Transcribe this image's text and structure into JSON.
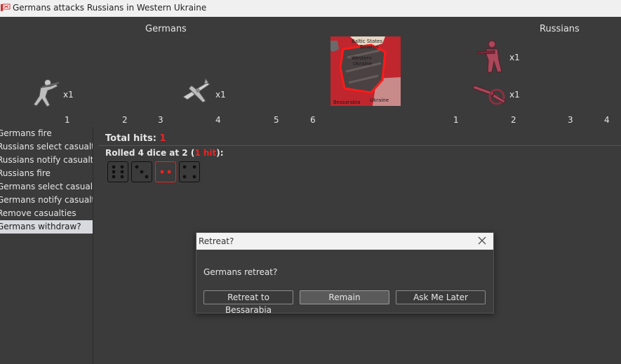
{
  "window": {
    "title": "Germans attacks Russians in Western Ukraine"
  },
  "attacker": {
    "name": "Germans",
    "units": [
      {
        "icon": "infantry-icon",
        "count": "x1"
      },
      {
        "icon": "fighter-plane-icon",
        "count": "x1"
      }
    ],
    "columns": [
      "1",
      "2",
      "3",
      "4",
      "5",
      "6"
    ]
  },
  "defender": {
    "name": "Russians",
    "units": [
      {
        "icon": "infantry-icon",
        "count": "x1"
      },
      {
        "icon": "artillery-icon",
        "count": "x1"
      }
    ],
    "columns": [
      "1",
      "2",
      "3",
      "4"
    ]
  },
  "territory": {
    "name_line1": "Western",
    "name_line2": "Ukraine",
    "top_label_line1": "Baltic States",
    "top_label_line2": "Belarus",
    "bottom_left_label": "Bessarabia",
    "bottom_right_label": "Ukraine",
    "colors": {
      "owner": "#c0262e",
      "highlight": "#ff1a1a"
    }
  },
  "steps": [
    "Germans fire",
    "Russians select casualties",
    "Russians notify casualties",
    "Russians fire",
    "Germans select casualties",
    "Germans notify casualties",
    "Remove casualties",
    "Germans withdraw?"
  ],
  "active_step": 7,
  "results": {
    "total_hits_label": "Total hits:",
    "total_hits": "1",
    "rolled_prefix": "Rolled 4 dice at 2 (",
    "rolled_hits": "1 hit",
    "rolled_suffix": "):",
    "dice": [
      6,
      3,
      2,
      4
    ],
    "hit_die_index": 2
  },
  "dialog": {
    "title": "Retreat?",
    "message": "Germans retreat?",
    "buttons": {
      "retreat": "Retreat to Bessarabia",
      "remain": "Remain",
      "later": "Ask Me Later"
    }
  }
}
